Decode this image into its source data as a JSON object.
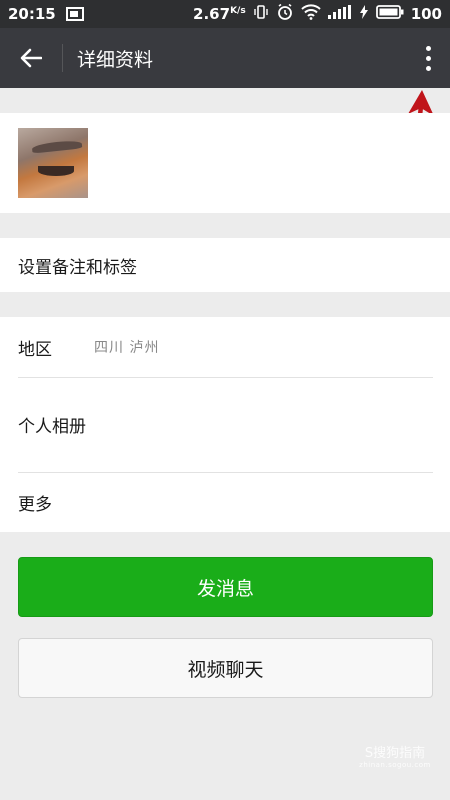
{
  "status_bar": {
    "time": "20:15",
    "net_speed": "2.67",
    "net_unit": "K/s",
    "battery": "100"
  },
  "title_bar": {
    "back_icon": "arrow-left-icon",
    "title": "详细资料",
    "more_icon": "more-vertical-icon"
  },
  "annotation": {
    "arrow_color": "#c0141a"
  },
  "profile": {
    "avatar": "avatar-photo"
  },
  "remark": {
    "label": "设置备注和标签"
  },
  "info": {
    "region_label": "地区",
    "region_value": "四川  泸州",
    "album_label": "个人相册",
    "more_label": "更多"
  },
  "actions": {
    "send_message": "发消息",
    "video_chat": "视频聊天",
    "send_color": "#1aad19"
  },
  "watermark": {
    "main": "S搜狗指南",
    "sub": "zhinan.sogou.com"
  }
}
